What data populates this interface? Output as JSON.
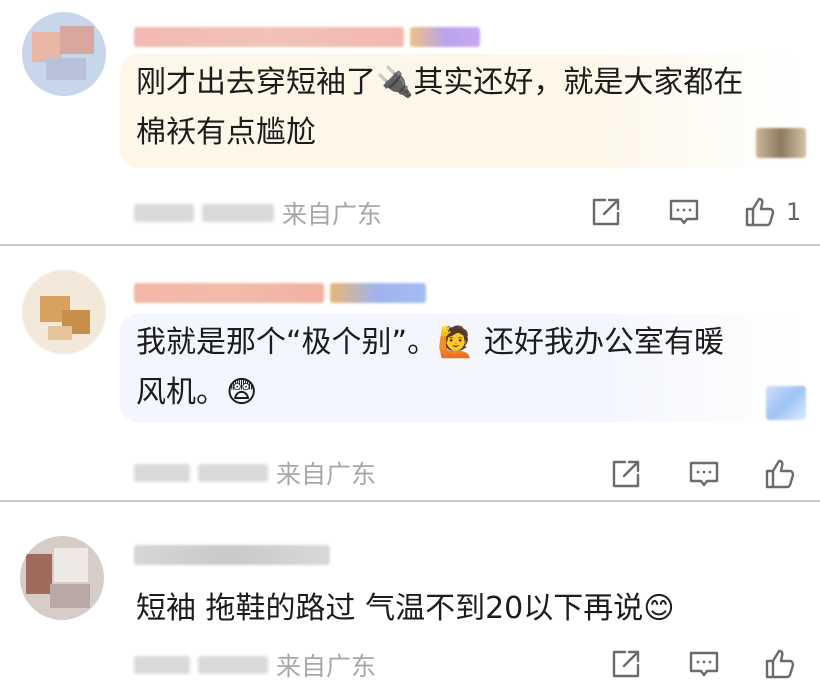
{
  "comments": [
    {
      "text": "刚才出去穿短袖了🔌其实还好，就是大家都在\n棉袄有点尴尬",
      "location": "来自广东",
      "like_count": "1",
      "bubble_color": "#fdf7ea"
    },
    {
      "text": "我就是那个“极个别”。🙋 还好我办公室有暖\n风机。😨",
      "location": "来自广东",
      "like_count": "",
      "bubble_color": "#f3f6fd"
    },
    {
      "text": "短袖 拖鞋的路过 气温不到20以下再说😊",
      "location": "来自广东",
      "like_count": "",
      "bubble_color": "#ffffff"
    }
  ],
  "icons": [
    "share-icon",
    "comment-icon",
    "like-icon"
  ],
  "colors": {
    "icon": "#6b6b6b",
    "meta_text": "#a7a7a7",
    "divider": "#c9c9c9"
  }
}
